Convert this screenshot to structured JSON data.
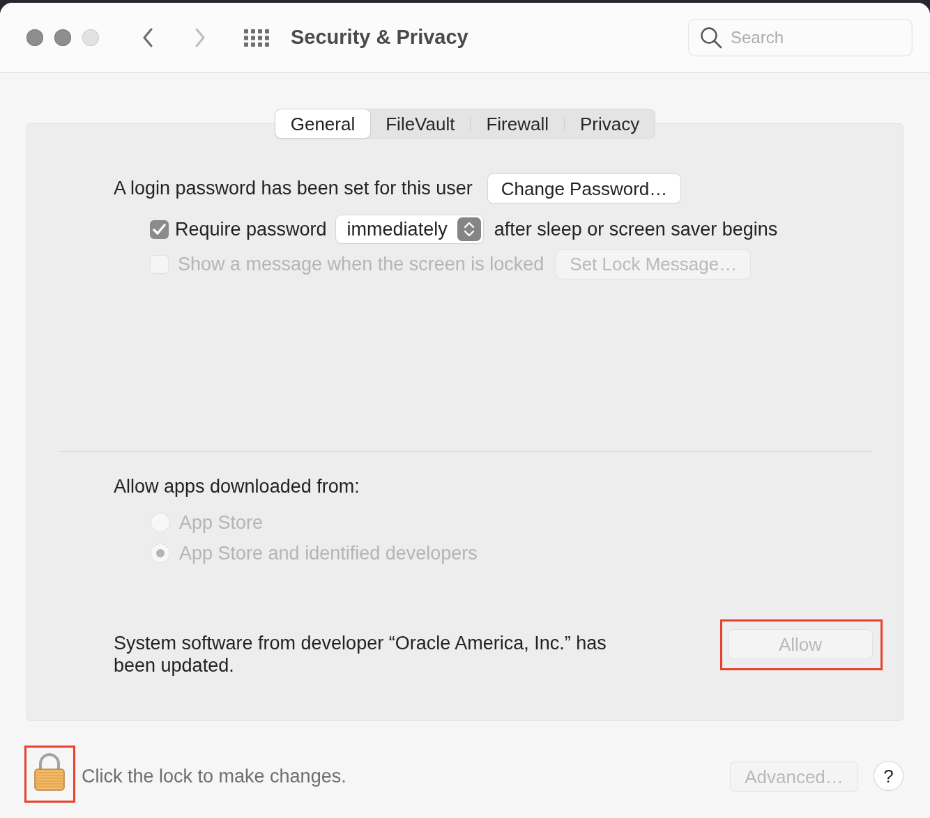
{
  "window": {
    "title": "Security & Privacy",
    "nav": {
      "back": {
        "disabled": false
      },
      "forward": {
        "disabled": true
      }
    },
    "search": {
      "placeholder": "Search"
    }
  },
  "tabs": [
    {
      "label": "General",
      "selected": true
    },
    {
      "label": "FileVault",
      "selected": false
    },
    {
      "label": "Firewall",
      "selected": false
    },
    {
      "label": "Privacy",
      "selected": false
    }
  ],
  "general": {
    "password_status": "A login password has been set for this user",
    "change_password_button": {
      "label": "Change Password…",
      "disabled": false
    },
    "require_password": {
      "label": "Require password",
      "checked": true,
      "disabled": false,
      "popup_value": "immediately",
      "suffix": "after sleep or screen saver begins"
    },
    "lock_message": {
      "label": "Show a message when the screen is locked",
      "checked": false,
      "disabled": true,
      "button": {
        "label": "Set Lock Message…",
        "disabled": true
      }
    }
  },
  "gatekeeper": {
    "heading": "Allow apps downloaded from:",
    "options": [
      {
        "label": "App Store",
        "selected": false,
        "disabled": true
      },
      {
        "label": "App Store and identified developers",
        "selected": true,
        "disabled": true
      }
    ]
  },
  "system_extension": {
    "message": "System software from developer “Oracle America, Inc.” has been updated.",
    "allow_button": {
      "label": "Allow",
      "disabled": true,
      "highlighted": true
    }
  },
  "footer": {
    "lock": {
      "locked": true,
      "highlighted": true
    },
    "lock_text": "Click the lock to make changes.",
    "advanced_button": {
      "label": "Advanced…",
      "disabled": true
    },
    "help_button": "?"
  }
}
